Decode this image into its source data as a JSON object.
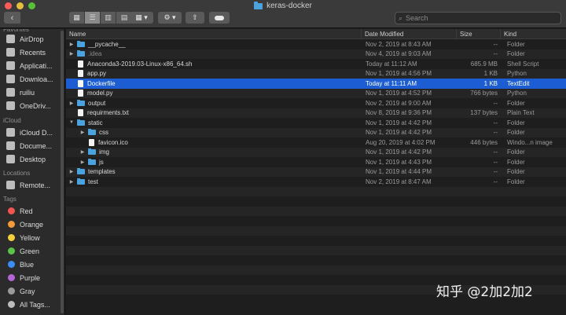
{
  "window": {
    "title": "keras-docker"
  },
  "colors": {
    "close": "#fc5b57",
    "minimize": "#e5bf3c",
    "maximize": "#57c038",
    "folder": "#4aa3df",
    "selection": "#1c5dd3"
  },
  "toolbar": {
    "back_icon": "‹",
    "share_icon": "⇧",
    "search_placeholder": "Search"
  },
  "sidebar": {
    "favorites_header": "Favorites",
    "favorites": [
      {
        "label": "AirDrop",
        "icon": "airdrop-icon"
      },
      {
        "label": "Recents",
        "icon": "clock-icon"
      },
      {
        "label": "Applicati...",
        "icon": "applications-icon"
      },
      {
        "label": "Downloa...",
        "icon": "download-icon"
      },
      {
        "label": "ruiliu",
        "icon": "home-icon"
      },
      {
        "label": "OneDriv...",
        "icon": "cloud-icon"
      }
    ],
    "icloud_header": "iCloud",
    "icloud": [
      {
        "label": "iCloud D...",
        "icon": "cloud-icon"
      },
      {
        "label": "Docume...",
        "icon": "document-icon"
      },
      {
        "label": "Desktop",
        "icon": "desktop-icon"
      }
    ],
    "locations_header": "Locations",
    "locations": [
      {
        "label": "Remote...",
        "icon": "disk-icon"
      }
    ],
    "tags_header": "Tags",
    "tags": [
      {
        "label": "Red",
        "color": "#f2544f"
      },
      {
        "label": "Orange",
        "color": "#f59a3a"
      },
      {
        "label": "Yellow",
        "color": "#f4cf3c"
      },
      {
        "label": "Green",
        "color": "#5bc24a"
      },
      {
        "label": "Blue",
        "color": "#3a8df5"
      },
      {
        "label": "Purple",
        "color": "#b566d6"
      },
      {
        "label": "Gray",
        "color": "#9a9a9a"
      },
      {
        "label": "All Tags...",
        "color": "#bdbdbd"
      }
    ]
  },
  "columns": {
    "name": "Name",
    "date": "Date Modified",
    "size": "Size",
    "kind": "Kind"
  },
  "files": [
    {
      "name": "__pycache__",
      "date": "Nov 2, 2019 at 8:43 AM",
      "size": "--",
      "kind": "Folder",
      "type": "folder",
      "expanded": false,
      "indent": 0
    },
    {
      "name": ".idea",
      "date": "Nov 4, 2019 at 9:03 AM",
      "size": "--",
      "kind": "Folder",
      "type": "folder",
      "expanded": false,
      "indent": 0,
      "dim": true
    },
    {
      "name": "Anaconda3-2019.03-Linux-x86_64.sh",
      "date": "Today at 11:12 AM",
      "size": "685.9 MB",
      "kind": "Shell Script",
      "type": "file",
      "indent": 0
    },
    {
      "name": "app.py",
      "date": "Nov 1, 2019 at 4:56 PM",
      "size": "1 KB",
      "kind": "Python",
      "type": "file",
      "indent": 0
    },
    {
      "name": "Dockerfile",
      "date": "Today at 11:11 AM",
      "size": "1 KB",
      "kind": "TextEdit",
      "type": "file",
      "indent": 0,
      "selected": true
    },
    {
      "name": "model.py",
      "date": "Nov 1, 2019 at 4:52 PM",
      "size": "766 bytes",
      "kind": "Python",
      "type": "file",
      "indent": 0
    },
    {
      "name": "output",
      "date": "Nov 2, 2019 at 9:00 AM",
      "size": "--",
      "kind": "Folder",
      "type": "folder",
      "expanded": false,
      "indent": 0
    },
    {
      "name": "requirments.txt",
      "date": "Nov 8, 2019 at 9:36 PM",
      "size": "137 bytes",
      "kind": "Plain Text",
      "type": "file",
      "indent": 0
    },
    {
      "name": "static",
      "date": "Nov 1, 2019 at 4:42 PM",
      "size": "--",
      "kind": "Folder",
      "type": "folder",
      "expanded": true,
      "indent": 0
    },
    {
      "name": "css",
      "date": "Nov 1, 2019 at 4:42 PM",
      "size": "--",
      "kind": "Folder",
      "type": "folder",
      "expanded": false,
      "indent": 1
    },
    {
      "name": "favicon.ico",
      "date": "Aug 20, 2019 at 4:02 PM",
      "size": "446 bytes",
      "kind": "Windo...n image",
      "type": "file",
      "indent": 1
    },
    {
      "name": "img",
      "date": "Nov 1, 2019 at 4:42 PM",
      "size": "--",
      "kind": "Folder",
      "type": "folder",
      "expanded": false,
      "indent": 1
    },
    {
      "name": "js",
      "date": "Nov 1, 2019 at 4:43 PM",
      "size": "--",
      "kind": "Folder",
      "type": "folder",
      "expanded": false,
      "indent": 1
    },
    {
      "name": "templates",
      "date": "Nov 1, 2019 at 4:44 PM",
      "size": "--",
      "kind": "Folder",
      "type": "folder",
      "expanded": false,
      "indent": 0
    },
    {
      "name": "test",
      "date": "Nov 2, 2019 at 8:47 AM",
      "size": "--",
      "kind": "Folder",
      "type": "folder",
      "expanded": false,
      "indent": 0
    }
  ],
  "watermark": "知乎 @2加2加2"
}
